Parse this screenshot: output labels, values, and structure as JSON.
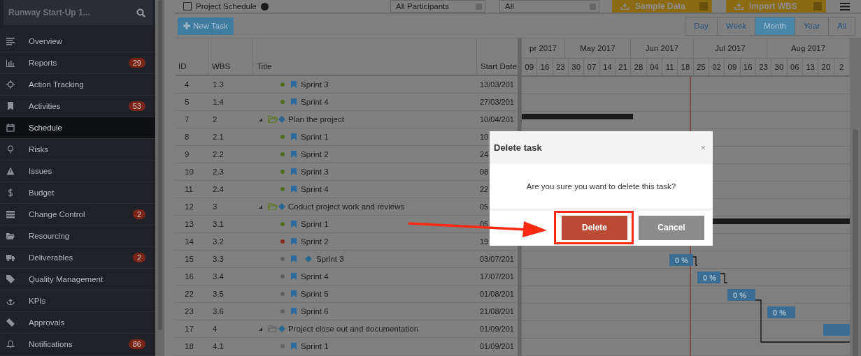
{
  "sidebar": {
    "search": {
      "value": "Runway Start-Up 1..."
    },
    "items": [
      {
        "label": "Overview",
        "selected": false
      },
      {
        "label": "Reports",
        "badge": "29",
        "selected": false
      },
      {
        "label": "Action Tracking",
        "selected": false
      },
      {
        "label": "Activities",
        "badge": "53",
        "selected": false
      },
      {
        "label": "Schedule",
        "selected": true
      },
      {
        "label": "Risks",
        "selected": false
      },
      {
        "label": "Issues",
        "selected": false
      },
      {
        "label": "Budget",
        "selected": false
      },
      {
        "label": "Change Control",
        "badge": "2",
        "selected": false
      },
      {
        "label": "Resourcing",
        "selected": false
      },
      {
        "label": "Deliverables",
        "badge": "2",
        "selected": false
      },
      {
        "label": "Quality Management",
        "selected": false
      },
      {
        "label": "KPIs",
        "selected": false
      },
      {
        "label": "Approvals",
        "selected": false
      },
      {
        "label": "Notifications",
        "badge": "86",
        "selected": false
      }
    ]
  },
  "toolbar": {
    "checkbox": {
      "label": "Project Schedule",
      "checked": false
    },
    "participants": {
      "value": "All Participants"
    },
    "filter": {
      "value": "All"
    },
    "buttons": [
      "Sample Data",
      "Import WBS"
    ]
  },
  "actions": {
    "new_task": "New Task",
    "views": [
      {
        "label": "Day",
        "selected": false
      },
      {
        "label": "Week",
        "selected": false
      },
      {
        "label": "Month",
        "selected": true
      },
      {
        "label": "Year",
        "selected": false
      },
      {
        "label": "All",
        "selected": false
      }
    ]
  },
  "table": {
    "columns": [
      "ID",
      "WBS",
      "Title",
      "Start Date"
    ],
    "rows": [
      {
        "id": "4",
        "wbs": "1.3",
        "title": "Sprint 3",
        "start": "13/03/201",
        "kind": "task",
        "color": "#4f6b1c"
      },
      {
        "id": "5",
        "wbs": "1.4",
        "title": "Sprint 4",
        "start": "27/03/201",
        "kind": "task",
        "color": "#4f6b1c"
      },
      {
        "id": "7",
        "wbs": "2",
        "title": "Plan the project",
        "start": "10/04/201",
        "kind": "group",
        "expanded": true,
        "color": "#5f7a2a",
        "children": [
          {
            "id": "8",
            "wbs": "2.1",
            "title": "Sprint 1",
            "start": "10",
            "kind": "task",
            "color": "#4f6b1c"
          },
          {
            "id": "9",
            "wbs": "2.2",
            "title": "Sprint 2",
            "start": "24",
            "kind": "task",
            "color": "#4f6b1c"
          },
          {
            "id": "10",
            "wbs": "2.3",
            "title": "Sprint 3",
            "start": "08",
            "kind": "task",
            "color": "#4f6b1c"
          },
          {
            "id": "11",
            "wbs": "2.4",
            "title": "Sprint 4",
            "start": "22",
            "kind": "task",
            "color": "#4f6b1c"
          }
        ]
      },
      {
        "id": "12",
        "wbs": "3",
        "title": "Coduct project work and reviews",
        "start": "05",
        "kind": "group",
        "expanded": true,
        "color": "#5f7a2a",
        "children": [
          {
            "id": "13",
            "wbs": "3.1",
            "title": "Sprint 1",
            "start": "05",
            "kind": "task",
            "color": "#4f6b1c"
          },
          {
            "id": "14",
            "wbs": "3.2",
            "title": "Sprint 2",
            "start": "19",
            "kind": "task",
            "color": "#8a2a22"
          },
          {
            "id": "15",
            "wbs": "3.3",
            "title": "Sprint 3",
            "start": "03/07/201",
            "kind": "milestone",
            "color": "#606060",
            "bar_label": "0 %"
          },
          {
            "id": "16",
            "wbs": "3.4",
            "title": "Sprint 4",
            "start": "17/07/201",
            "kind": "task",
            "color": "#606060",
            "bar_label": "0 %"
          },
          {
            "id": "22",
            "wbs": "3.5",
            "title": "Sprint 5",
            "start": "01/08/201",
            "kind": "task",
            "color": "#606060",
            "bar_label": "0 %"
          },
          {
            "id": "23",
            "wbs": "3.6",
            "title": "Sprint 6",
            "start": "21/08/201",
            "kind": "task",
            "color": "#606060",
            "bar_label": "0 %"
          }
        ]
      },
      {
        "id": "17",
        "wbs": "4",
        "title": "Project close out and documentation",
        "start": "01/09/201",
        "kind": "group",
        "expanded": true,
        "color": "#6a6a6a",
        "children": [
          {
            "id": "18",
            "wbs": "4.1",
            "title": "Sprint 1",
            "start": "01/09/201",
            "kind": "task",
            "color": "#606060"
          }
        ]
      }
    ]
  },
  "gantt": {
    "months": [
      "pr 2017",
      "May 2017",
      "Jun 2017",
      "Jul 2017",
      "Aug 2017"
    ],
    "days": [
      "09",
      "16",
      "23",
      "30",
      "07",
      "14",
      "21",
      "28",
      "04",
      "11",
      "18",
      "25",
      "02",
      "09",
      "16",
      "23",
      "30",
      "06",
      "13",
      "20",
      "2"
    ]
  },
  "dialog": {
    "title": "Delete task",
    "close": "×",
    "message": "Are you sure you want to delete this task?",
    "buttons": [
      {
        "label": "Delete",
        "kind": "danger"
      },
      {
        "label": "Cancel",
        "kind": "secondary"
      }
    ]
  }
}
